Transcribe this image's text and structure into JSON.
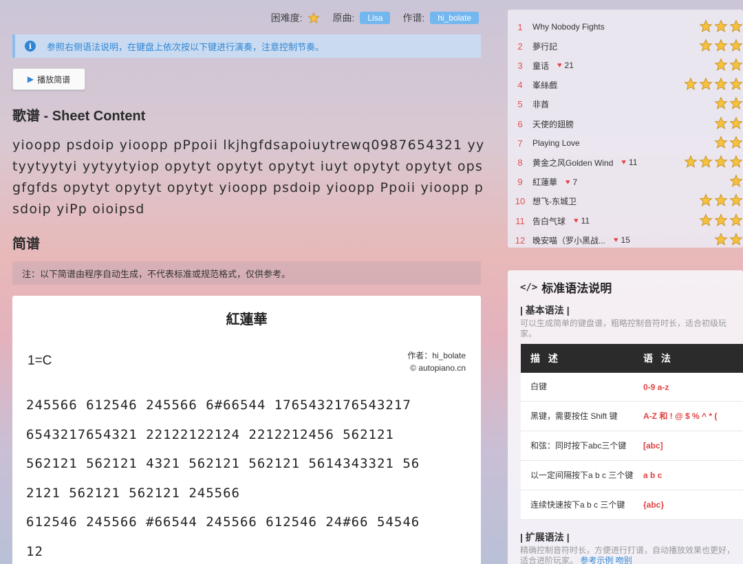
{
  "header": {
    "difficulty_label": "困难度:",
    "original_label": "原曲:",
    "original_value": "Lisa",
    "arranger_label": "作谱:",
    "arranger_value": "hi_bolate"
  },
  "info_alert": "参照右侧语法说明，在键盘上依次按以下键进行演奏，注意控制节奏。",
  "play_button": "播放简谱",
  "sheet": {
    "heading": "歌谱 - Sheet Content",
    "content": "yioopp psdoip yioopp pPpoii lkjhgfdsapoiuytrewq0987654321 yytyytyytyi yytyytyiop opytyt opytyt opytyt iuyt opytyt opytyt opsgfgfds opytyt opytyt opytyt yioopp psdoip yioopp Ppoii yioopp psdoip yiPp oioipsd"
  },
  "jianpu": {
    "heading": "简谱",
    "note": "注：以下简谱由程序自动生成，不代表标准或规范格式，仅供参考。",
    "title": "紅蓮華",
    "key": "1=C",
    "author": "作者：hi_bolate",
    "copyright": "© autopiano.cn",
    "lines": [
      "245566 612546 245566 6#66544 1765432176543217",
      "6543217654321 22122122124 2212212456 562121",
      "562121 562121 4321 562121 562121 5614343321 56",
      "2121 562121 562121 245566",
      "612546 245566 #66544 245566 612546 24#66 54546",
      "12"
    ]
  },
  "ranking": [
    {
      "num": "1",
      "title": "Why Nobody Fights",
      "likes": "",
      "stars": 3
    },
    {
      "num": "2",
      "title": "夢行記",
      "likes": "",
      "stars": 3
    },
    {
      "num": "3",
      "title": "童话",
      "likes": "21",
      "stars": 2
    },
    {
      "num": "4",
      "title": "峯絲戲",
      "likes": "",
      "stars": 4
    },
    {
      "num": "5",
      "title": "非酋",
      "likes": "",
      "stars": 2
    },
    {
      "num": "6",
      "title": "天使的翅膀",
      "likes": "",
      "stars": 2
    },
    {
      "num": "7",
      "title": "Playing Love",
      "likes": "",
      "stars": 2
    },
    {
      "num": "8",
      "title": "黄金之风Golden Wind",
      "likes": "11",
      "stars": 4
    },
    {
      "num": "9",
      "title": "紅蓮華",
      "likes": "7",
      "stars": 1
    },
    {
      "num": "10",
      "title": "想飞-东城卫",
      "likes": "",
      "stars": 3
    },
    {
      "num": "11",
      "title": "告白气球",
      "likes": "11",
      "stars": 3
    },
    {
      "num": "12",
      "title": "晚安喵（罗小黑战...",
      "likes": "15",
      "stars": 2
    }
  ],
  "syntax": {
    "heading": "标准语法说明",
    "basic_heading": "| 基本语法 |",
    "basic_desc": "可以生成简单的键盘谱，粗略控制音符时长，适合初级玩家。",
    "table_headers": [
      "描 述",
      "语 法"
    ],
    "rows": [
      {
        "desc": "白键",
        "syntax": "0-9 a-z"
      },
      {
        "desc": "黑键，需要按住 Shift 键",
        "syntax": "A-Z 和 ! @ $ % ^ * ("
      },
      {
        "desc": "和弦：同时按下abc三个键",
        "syntax": "[abc]"
      },
      {
        "desc": "以一定间隔按下a b c 三个键",
        "syntax": "a b c"
      },
      {
        "desc": "连续快速按下a b c 三个键",
        "syntax": "{abc}"
      }
    ],
    "ext_heading": "| 扩展语法 |",
    "ext_desc": "精确控制音符时长，方便进行打谱，自动播放效果也更好，适合进阶玩家。",
    "ext_link": "参考示例  吻别"
  },
  "colors": {
    "accent_blue": "#2f86d4",
    "rank_red": "#e25050",
    "star_gold": "#f6c23e"
  }
}
